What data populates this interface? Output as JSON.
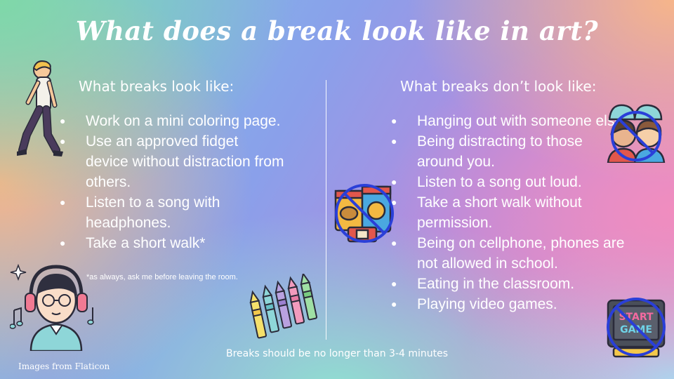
{
  "title": "What does a break look like in art?",
  "left_column": {
    "heading": "What breaks look like:",
    "items": [
      "Work on a mini coloring page.",
      "Use an approved fidget device without distraction from others.",
      "Listen to a song with headphones.",
      "Take a short walk*"
    ],
    "note": "*as always, ask me before leaving the room."
  },
  "right_column": {
    "heading": "What breaks don’t look like:",
    "items": [
      "Hanging out with someone else.",
      "Being distracting to those around you.",
      "Listen to a song out loud.",
      "Take a short walk without permission.",
      "Being on cellphone, phones are not allowed in school.",
      "Eating in the classroom.",
      "Playing video games."
    ]
  },
  "footer": "Breaks should be no longer than 3-4 minutes",
  "credit": "Images from Flaticon",
  "game_icon_text": {
    "line1": "START",
    "line2": "GAME"
  },
  "icons": [
    "walking-person-icon",
    "headphones-student-icon",
    "crayons-icon",
    "snack-food-icon",
    "friends-prohibited-icon",
    "video-game-prohibited-icon"
  ],
  "colors": {
    "text": "#ffffff",
    "prohibit": "#2a3fd8"
  }
}
